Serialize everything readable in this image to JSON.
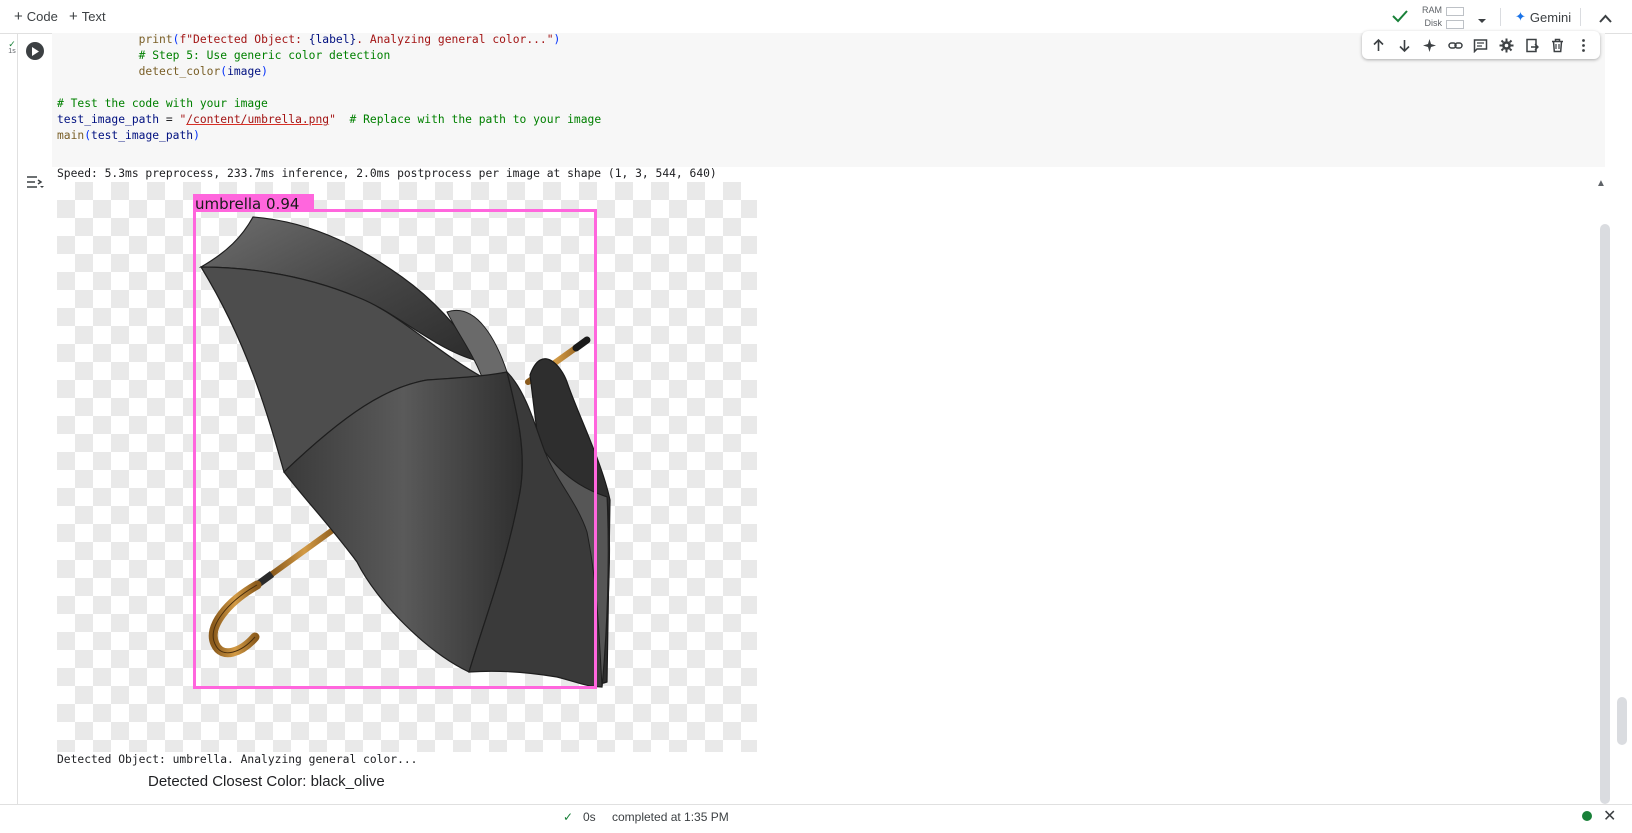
{
  "toolbar": {
    "add_code": "Code",
    "add_text": "Text",
    "ram_label": "RAM",
    "disk_label": "Disk",
    "gemini_label": "Gemini"
  },
  "cell": {
    "run_time": "1s",
    "code_lines": {
      "l1_indent": "            ",
      "l1_fn": "print",
      "l1_str_a": "f\"Detected Object: ",
      "l1_var": "{label}",
      "l1_str_b": ". Analyzing general color...\"",
      "l2": "            # Step 5: Use generic color detection",
      "l3_indent": "            ",
      "l3_fn": "detect_color",
      "l3_arg": "image",
      "l4": "# Test the code with your image",
      "l5_var": "test_image_path",
      "l5_eq": " = ",
      "l5_q1": "\"",
      "l5_path": "/content/umbrella.png",
      "l5_q2": "\"",
      "l5_cmt": "  # Replace with the path to your image",
      "l6_fn": "main",
      "l6_arg": "test_image_path"
    }
  },
  "output": {
    "speed_line": "Speed: 5.3ms preprocess, 233.7ms inference, 2.0ms postprocess per image at shape (1, 3, 544, 640)",
    "detection_label": "umbrella  0.94",
    "detection_color": "#ff66dd",
    "detected_object_line": "Detected Object: umbrella. Analyzing general color...",
    "closest_color_line": "Detected Closest Color: black_olive"
  },
  "status": {
    "time": "0s",
    "completed": "completed at 1:35 PM"
  },
  "colors": {
    "accent": "#1a73e8",
    "success": "#188038"
  }
}
